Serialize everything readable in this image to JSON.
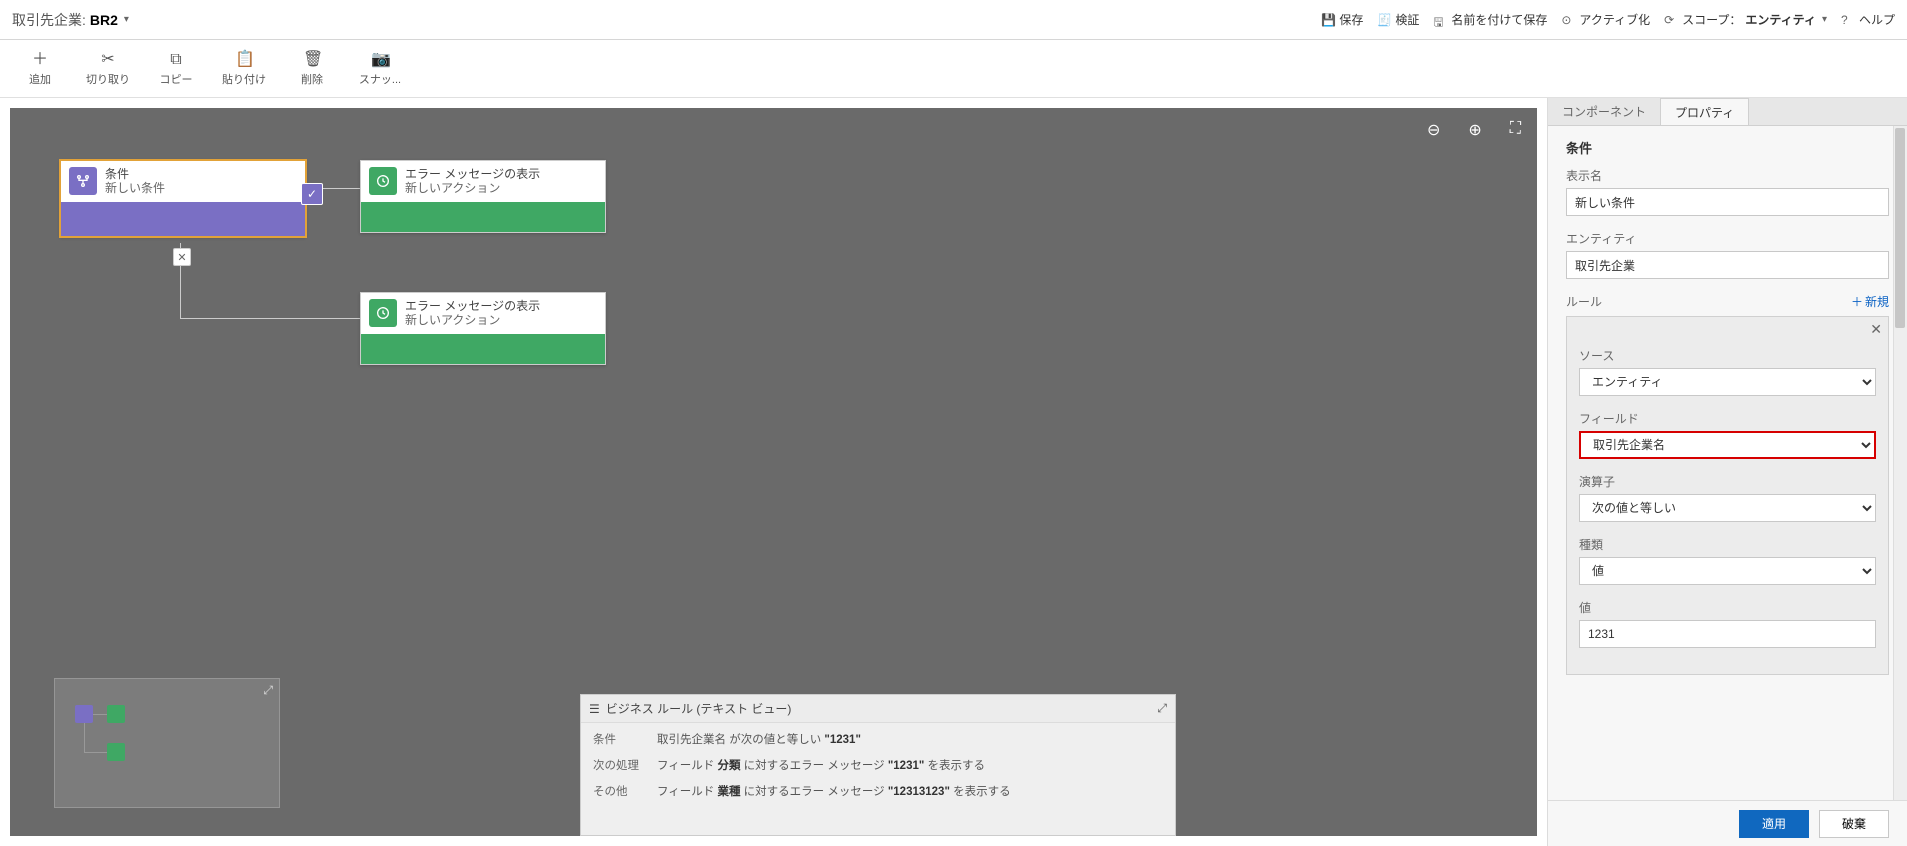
{
  "header": {
    "title_label": "取引先企業:",
    "title_name": "BR2",
    "actions": {
      "save": "保存",
      "validate": "検証",
      "save_as": "名前を付けて保存",
      "activate": "アクティブ化",
      "scope_label": "スコープ：",
      "scope_value": "エンティティ",
      "help": "ヘルプ"
    }
  },
  "toolbar": {
    "add": "追加",
    "cut": "切り取り",
    "copy": "コピー",
    "paste": "貼り付け",
    "delete": "削除",
    "snapshot": "スナッ..."
  },
  "canvas": {
    "controls": {
      "zoom_out": "zoom-out",
      "zoom_in": "zoom-in",
      "fit": "fit"
    },
    "nodes": {
      "condition": {
        "title": "条件",
        "subtitle": "新しい条件"
      },
      "action1": {
        "title": "エラー メッセージの表示",
        "subtitle": "新しいアクション"
      },
      "action2": {
        "title": "エラー メッセージの表示",
        "subtitle": "新しいアクション"
      }
    }
  },
  "textview": {
    "title": "ビジネス ルール (テキスト ビュー)",
    "rows": {
      "cond_label": "条件",
      "cond_text_pre": "取引先企業名 ",
      "cond_text_mid": "が次の値と等しい ",
      "cond_text_val": "\"1231\"",
      "then_label": "次の処理",
      "then_text_1a": "フィールド ",
      "then_text_1b": "分類",
      "then_text_1c": " に対するエラー メッセージ ",
      "then_text_1d": "\"1231\"",
      "then_text_1e": " を表示する",
      "else_label": "その他",
      "else_text_1a": "フィールド ",
      "else_text_1b": "業種",
      "else_text_1c": " に対するエラー メッセージ ",
      "else_text_1d": "\"12313123\"",
      "else_text_1e": " を表示する"
    }
  },
  "sidebar": {
    "tabs": {
      "components": "コンポーネント",
      "properties": "プロパティ"
    },
    "section_title": "条件",
    "display_name_label": "表示名",
    "display_name_value": "新しい条件",
    "entity_label": "エンティティ",
    "entity_value": "取引先企業",
    "rule_label": "ルール",
    "rule_new": "新規",
    "rule": {
      "source_label": "ソース",
      "source_value": "エンティティ",
      "field_label": "フィールド",
      "field_value": "取引先企業名",
      "operator_label": "演算子",
      "operator_value": "次の値と等しい",
      "type_label": "種類",
      "type_value": "値",
      "value_label": "値",
      "value_value": "1231"
    },
    "buttons": {
      "apply": "適用",
      "discard": "破棄"
    }
  }
}
